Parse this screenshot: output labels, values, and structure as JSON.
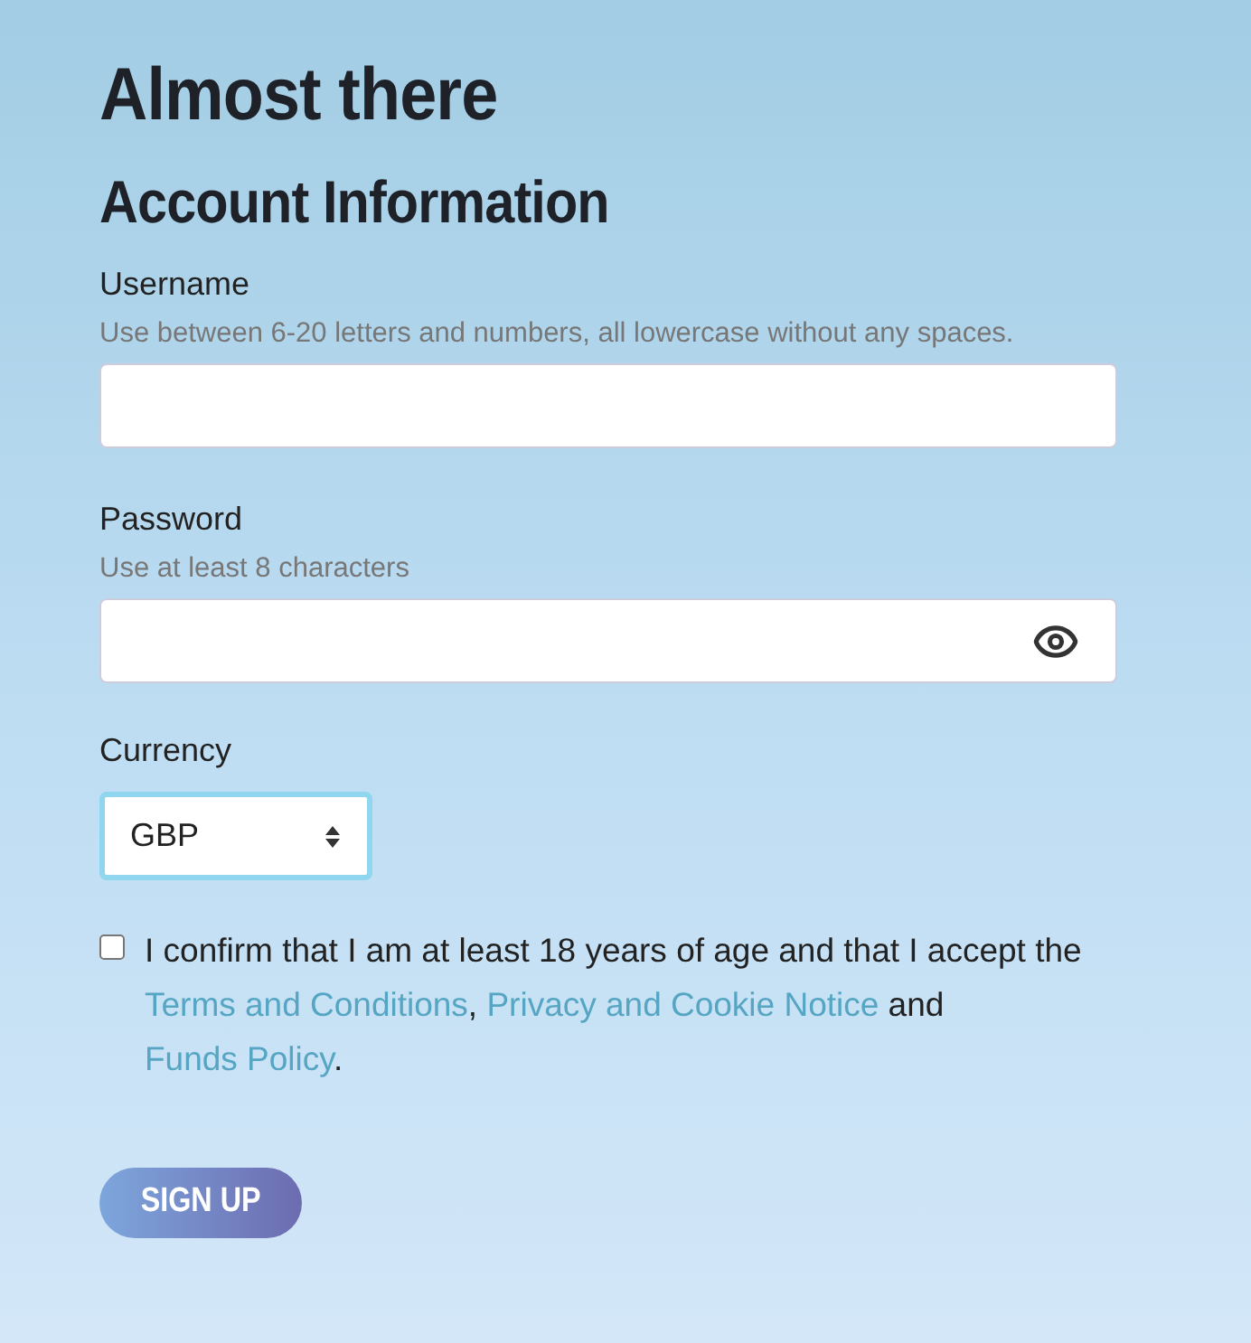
{
  "title": "Almost there",
  "section_title": "Account Information",
  "fields": [
    {
      "kind": "text",
      "label": "Username",
      "hint": "Use between 6-20 letters and numbers, all lowercase without any spaces."
    },
    {
      "kind": "password",
      "label": "Password",
      "hint": "Use at least 8 characters"
    }
  ],
  "currency": {
    "label": "Currency",
    "value": "GBP"
  },
  "consent": {
    "checked": false,
    "parts": [
      {
        "kind": "text",
        "text": "I confirm that I am at least 18 years of age and that I accept the "
      },
      {
        "kind": "link",
        "text": "Terms and Conditions"
      },
      {
        "kind": "text",
        "text": ", "
      },
      {
        "kind": "link",
        "text": "Privacy and Cookie Notice"
      },
      {
        "kind": "text",
        "text": " and "
      },
      {
        "kind": "link",
        "text": "Funds Policy"
      },
      {
        "kind": "text",
        "text": "."
      }
    ]
  },
  "submit": "SIGN UP"
}
